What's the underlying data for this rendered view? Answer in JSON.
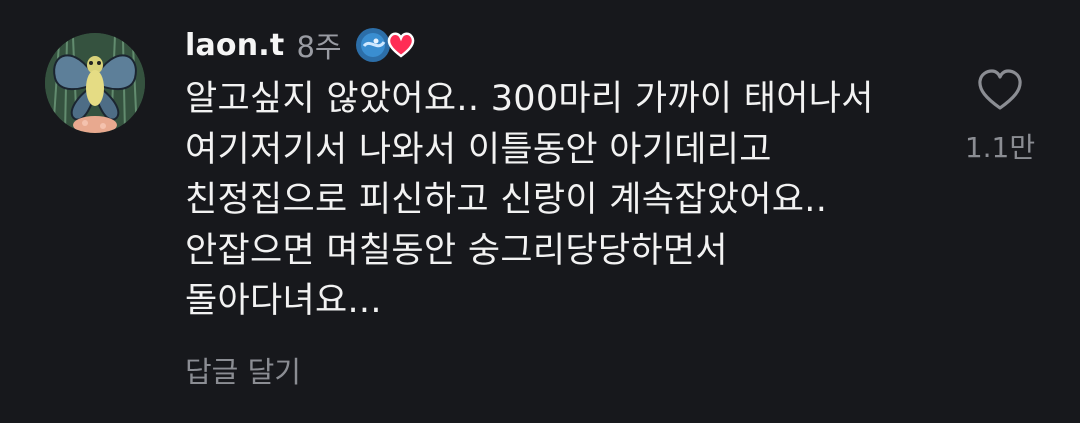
{
  "comment": {
    "username": "laon.t",
    "timestamp": "8주",
    "text": "알고싶지 않았어요.. 300마리 가까이 태어나서\n여기저기서 나와서 이틀동안 아기데리고\n친정집으로 피신하고 신랑이 계속잡았어요..\n안잡으면 며칠동안 숭그리당당하면서\n돌아다녀요...",
    "reply_label": "답글 달기",
    "like_count": "1.1만",
    "icons": {
      "like": "heart-outline-icon",
      "creator_like": "creator-liked-heart-icon"
    },
    "colors": {
      "background": "#17181c",
      "heart_red": "#ff2d55",
      "muted_text": "#8b8d93"
    }
  }
}
